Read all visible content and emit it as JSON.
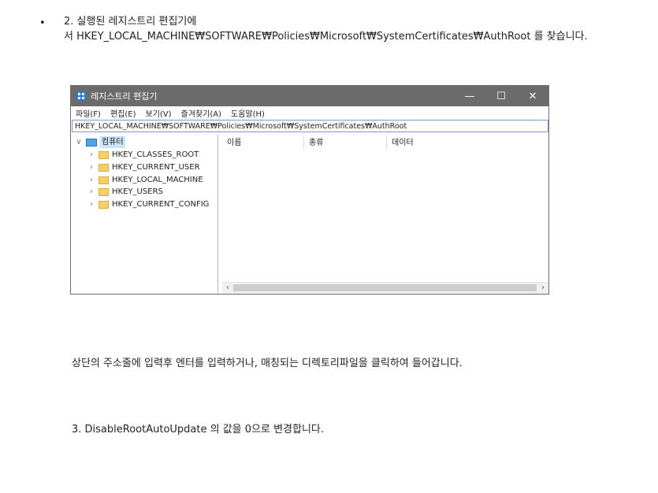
{
  "bullet": "•",
  "step2": {
    "line1": "2. 실행된 레지스트리 편집기에",
    "line2": "서 HKEY_LOCAL_MACHINE₩SOFTWARE₩Policies₩Microsoft₩SystemCertificates₩AuthRoot 를 찾습니다."
  },
  "regedit": {
    "title": "레지스트리 편집기",
    "controls": {
      "minimize": "—",
      "maximize": "☐",
      "close": "✕"
    },
    "menu": [
      "파일(F)",
      "편집(E)",
      "보기(V)",
      "즐겨찾기(A)",
      "도움말(H)"
    ],
    "address": "HKEY_LOCAL_MACHINE₩SOFTWARE₩Policies₩Microsoft₩SystemCertificates₩AuthRoot",
    "tree_root": "컴퓨터",
    "tree_items": [
      "HKEY_CLASSES_ROOT",
      "HKEY_CURRENT_USER",
      "HKEY_LOCAL_MACHINE",
      "HKEY_USERS",
      "HKEY_CURRENT_CONFIG"
    ],
    "columns": [
      "이름",
      "종류",
      "데이터"
    ]
  },
  "para1": "상단의 주소줄에 입력후 엔터를 입력하거나, 매칭되는 디렉토리파일을 클릭하여 들어갑니다.",
  "step3": "3. DisableRootAutoUpdate 의 값을 0으로 변경합니다."
}
